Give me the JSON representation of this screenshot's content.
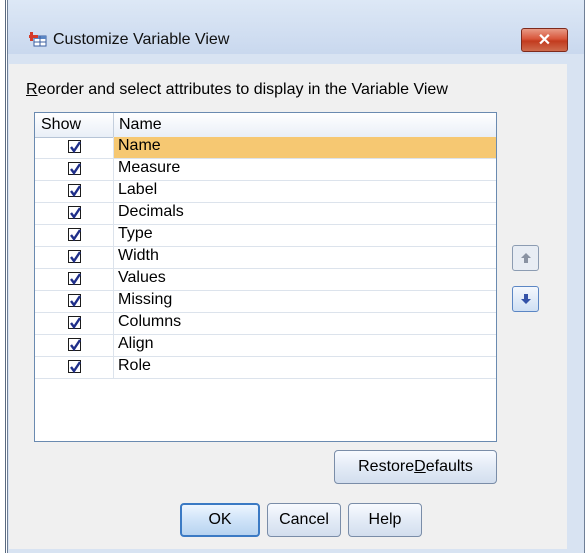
{
  "window": {
    "title": "Customize Variable View",
    "close_glyph": "✕"
  },
  "instruction": {
    "first_letter": "R",
    "rest": "eorder and select attributes to display in the Variable View"
  },
  "table": {
    "columns": {
      "show": "Show",
      "name": "Name"
    },
    "rows": [
      {
        "name": "Name",
        "checked": true,
        "selected": true
      },
      {
        "name": "Measure",
        "checked": true
      },
      {
        "name": "Label",
        "checked": true
      },
      {
        "name": "Decimals",
        "checked": true
      },
      {
        "name": "Type",
        "checked": true
      },
      {
        "name": "Width",
        "checked": true
      },
      {
        "name": "Values",
        "checked": true
      },
      {
        "name": "Missing",
        "checked": true
      },
      {
        "name": "Columns",
        "checked": true
      },
      {
        "name": "Align",
        "checked": true
      },
      {
        "name": "Role",
        "checked": true
      }
    ]
  },
  "buttons": {
    "restore_prefix": "Restore ",
    "restore_mnemonic": "D",
    "restore_suffix": "efaults",
    "ok": "OK",
    "cancel": "Cancel",
    "help": "Help"
  },
  "icons": {
    "title": "spss-table-icon",
    "move_up": "arrow-up-icon",
    "move_down": "arrow-down-icon",
    "checkbox": "checkmark-icon"
  },
  "colors": {
    "selection": "#f6c872",
    "close_button": "#c23b1e",
    "default_button_border": "#3b7ac4",
    "arrow": "#3352a8"
  }
}
